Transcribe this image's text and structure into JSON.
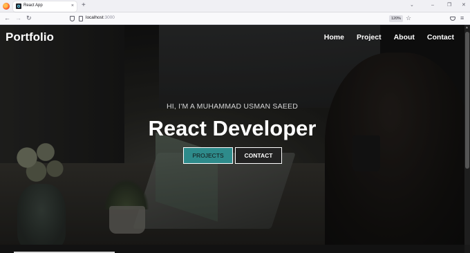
{
  "browser": {
    "tab_title": "React App",
    "tab_close": "×",
    "new_tab": "+",
    "list_tabs": "⌄",
    "win_min": "–",
    "win_max": "❐",
    "win_close": "✕",
    "back": "←",
    "forward": "→",
    "reload": "↻",
    "url_host": "localhost",
    "url_port": ":3000",
    "zoom": "120%",
    "bookmark": "☆",
    "menu": "≡"
  },
  "site": {
    "logo": "Portfolio",
    "nav": [
      "Home",
      "Project",
      "About",
      "Contact"
    ],
    "intro": "HI, I'M A MUHAMMAD USMAN SAEED",
    "headline": "React Developer",
    "projects_button": "PROJECTS",
    "contact_button": "CONTACT"
  },
  "colors": {
    "accent": "#2e8b8b",
    "overlay": "rgba(0,0,0,0.35)"
  },
  "icons": [
    "firefox-icon",
    "react-favicon",
    "shield-icon",
    "page-icon",
    "star-icon",
    "pocket-icon",
    "hamburger-menu-icon"
  ]
}
